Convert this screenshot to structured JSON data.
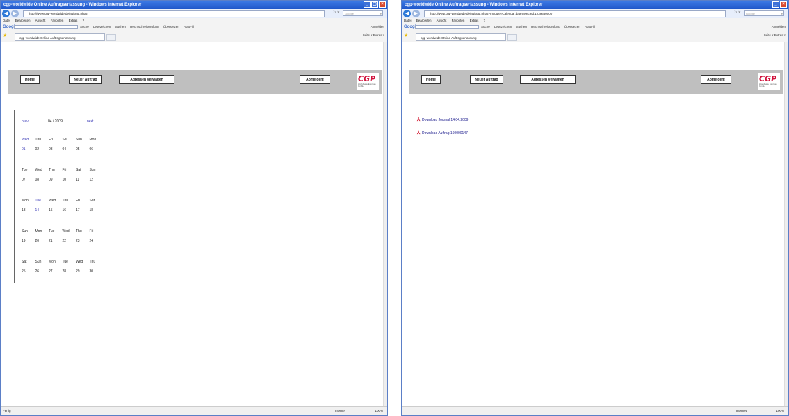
{
  "browser": {
    "title": "cgp-worldwide Online Auftragserfassung - Windows Internet Explorer",
    "menu": [
      "Datei",
      "Bearbeiten",
      "Ansicht",
      "Favoriten",
      "Extras",
      "?"
    ],
    "search_placeholder": "Google",
    "google_logo": "Google",
    "google_field": "",
    "google_tools": [
      "Suche",
      "Lesezeichen",
      "Suchen",
      "Rechtschreibprüfung",
      "Übersetzen",
      "AutoFill"
    ],
    "google_right": "Anmelden",
    "tab_title": "cgp-worldwide Online Auftragserfassung",
    "commandbar": "Seite ▾  Extras ▾",
    "zone": "Internet",
    "zoom": "100%"
  },
  "window1": {
    "url": "http://www.cgp-worldwide.de/auftrag.php5",
    "status": "Fertig"
  },
  "window2": {
    "url": "http://www.cgp-worldwide.de/auftrag.php5?module=Calendar.dateSelected:1239660000",
    "status": ""
  },
  "nav": {
    "home": "Home",
    "new_order": "Neuer Auftrag",
    "addresses": "Adressen Verwalten",
    "logout": "Abmelden!"
  },
  "logo": {
    "text": "CGP",
    "sub": "Worldwide Express GmbH"
  },
  "calendar": {
    "prev": "prev",
    "next": "next",
    "month": "04 / 2009",
    "weeks": [
      {
        "days": [
          "Wed",
          "Thu",
          "Fri",
          "Sat",
          "Sun",
          "Mon"
        ],
        "dates": [
          "01",
          "02",
          "03",
          "04",
          "05",
          "06"
        ],
        "hl_day": 0,
        "hl_date": 0
      },
      {
        "days": [
          "Tue",
          "Wed",
          "Thu",
          "Fri",
          "Sat",
          "Sun"
        ],
        "dates": [
          "07",
          "08",
          "09",
          "10",
          "11",
          "12"
        ],
        "hl_day": -1,
        "hl_date": -1
      },
      {
        "days": [
          "Mon",
          "Tue",
          "Wed",
          "Thu",
          "Fri",
          "Sat"
        ],
        "dates": [
          "13",
          "14",
          "15",
          "16",
          "17",
          "18"
        ],
        "hl_day": 1,
        "hl_date": 1
      },
      {
        "days": [
          "Sun",
          "Mon",
          "Tue",
          "Wed",
          "Thu",
          "Fri"
        ],
        "dates": [
          "19",
          "20",
          "21",
          "22",
          "23",
          "24"
        ],
        "hl_day": -1,
        "hl_date": -1
      },
      {
        "days": [
          "Sat",
          "Sun",
          "Mon",
          "Tue",
          "Wed",
          "Thu"
        ],
        "dates": [
          "25",
          "26",
          "27",
          "28",
          "29",
          "30"
        ],
        "hl_day": -1,
        "hl_date": -1
      }
    ]
  },
  "downloads": [
    "Download Journal 14.04.2009",
    "Download Auftrag 160000147"
  ]
}
